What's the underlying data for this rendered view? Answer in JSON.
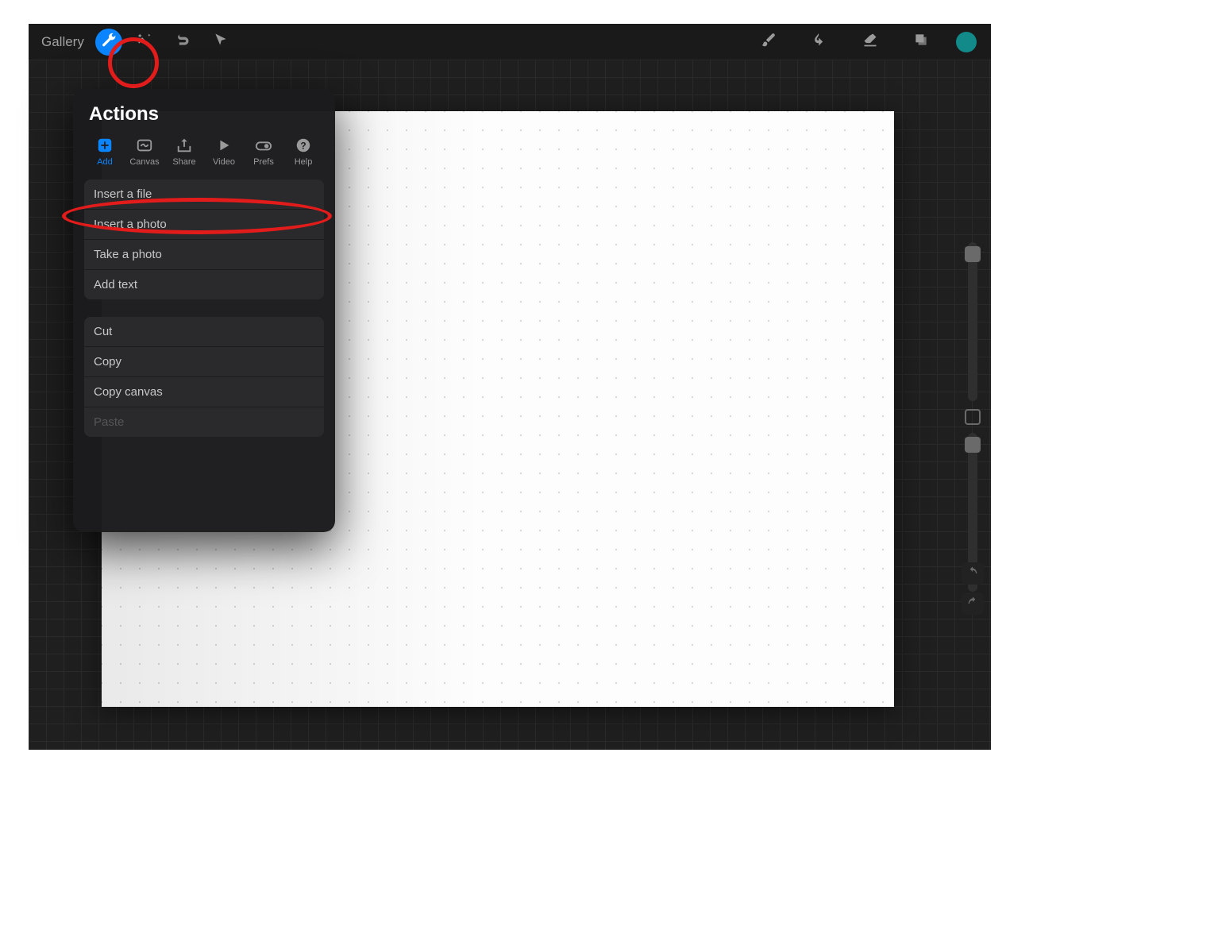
{
  "toolbar": {
    "gallery_label": "Gallery"
  },
  "actions_panel": {
    "title": "Actions",
    "tabs": [
      {
        "label": "Add",
        "icon": "add",
        "active": true
      },
      {
        "label": "Canvas",
        "icon": "canvas",
        "active": false
      },
      {
        "label": "Share",
        "icon": "share",
        "active": false
      },
      {
        "label": "Video",
        "icon": "video",
        "active": false
      },
      {
        "label": "Prefs",
        "icon": "prefs",
        "active": false
      },
      {
        "label": "Help",
        "icon": "help",
        "active": false
      }
    ],
    "group1": [
      "Insert a file",
      "Insert a photo",
      "Take a photo",
      "Add text"
    ],
    "group2": [
      {
        "label": "Cut",
        "disabled": false
      },
      {
        "label": "Copy",
        "disabled": false
      },
      {
        "label": "Copy canvas",
        "disabled": false
      },
      {
        "label": "Paste",
        "disabled": true
      }
    ]
  },
  "colors": {
    "accent": "#0a84ff",
    "swatch": "#128a8a",
    "annotation": "#e21b1b"
  }
}
